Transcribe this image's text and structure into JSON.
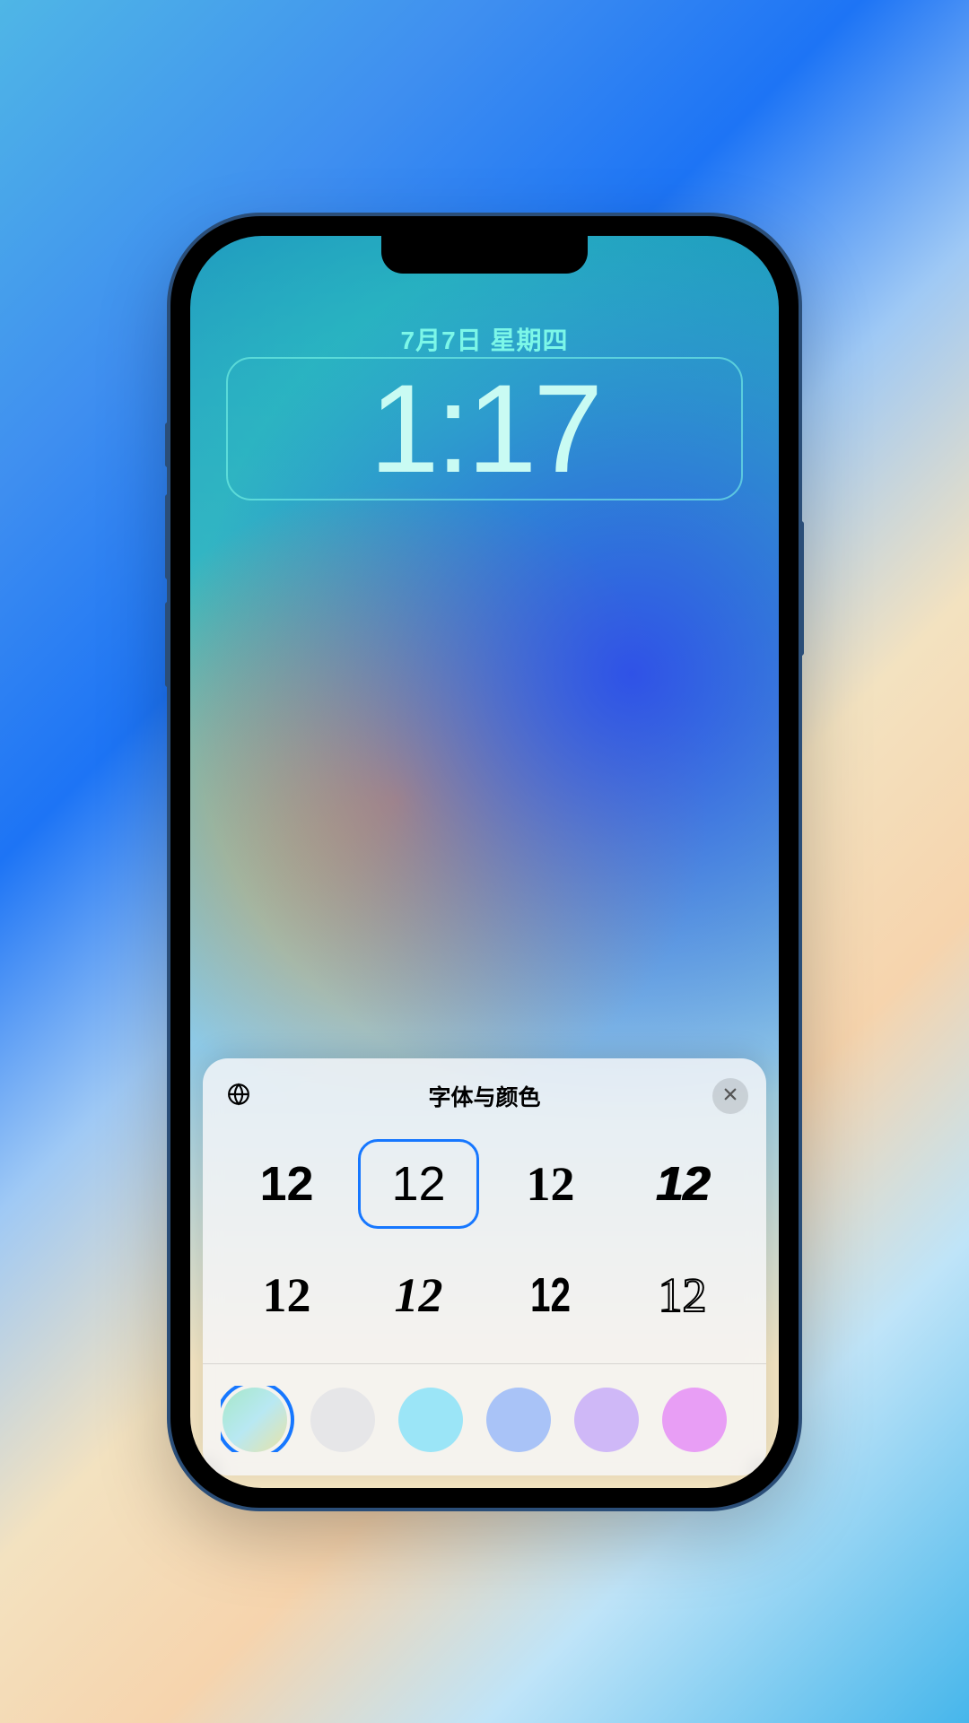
{
  "lockscreen": {
    "date": "7月7日 星期四",
    "time": "1:17"
  },
  "sheet": {
    "title": "字体与颜色",
    "fonts": [
      {
        "sample": "12",
        "selected": false
      },
      {
        "sample": "12",
        "selected": true
      },
      {
        "sample": "12",
        "selected": false
      },
      {
        "sample": "12",
        "selected": false
      },
      {
        "sample": "12",
        "selected": false
      },
      {
        "sample": "12",
        "selected": false
      },
      {
        "sample": "12",
        "selected": false
      },
      {
        "sample": "12",
        "selected": false
      }
    ],
    "colors": [
      {
        "css": "linear-gradient(135deg,#a6e7c8 0%,#b8e8f2 50%,#e7e3a6 100%)",
        "selected": true
      },
      {
        "css": "#e6e6e8",
        "selected": false
      },
      {
        "css": "#9be5f7",
        "selected": false
      },
      {
        "css": "#a9c3f7",
        "selected": false
      },
      {
        "css": "#cfb8f7",
        "selected": false
      },
      {
        "css": "#e89ef5",
        "selected": false
      },
      {
        "css": "#f7a9c6",
        "selected": false
      }
    ]
  }
}
